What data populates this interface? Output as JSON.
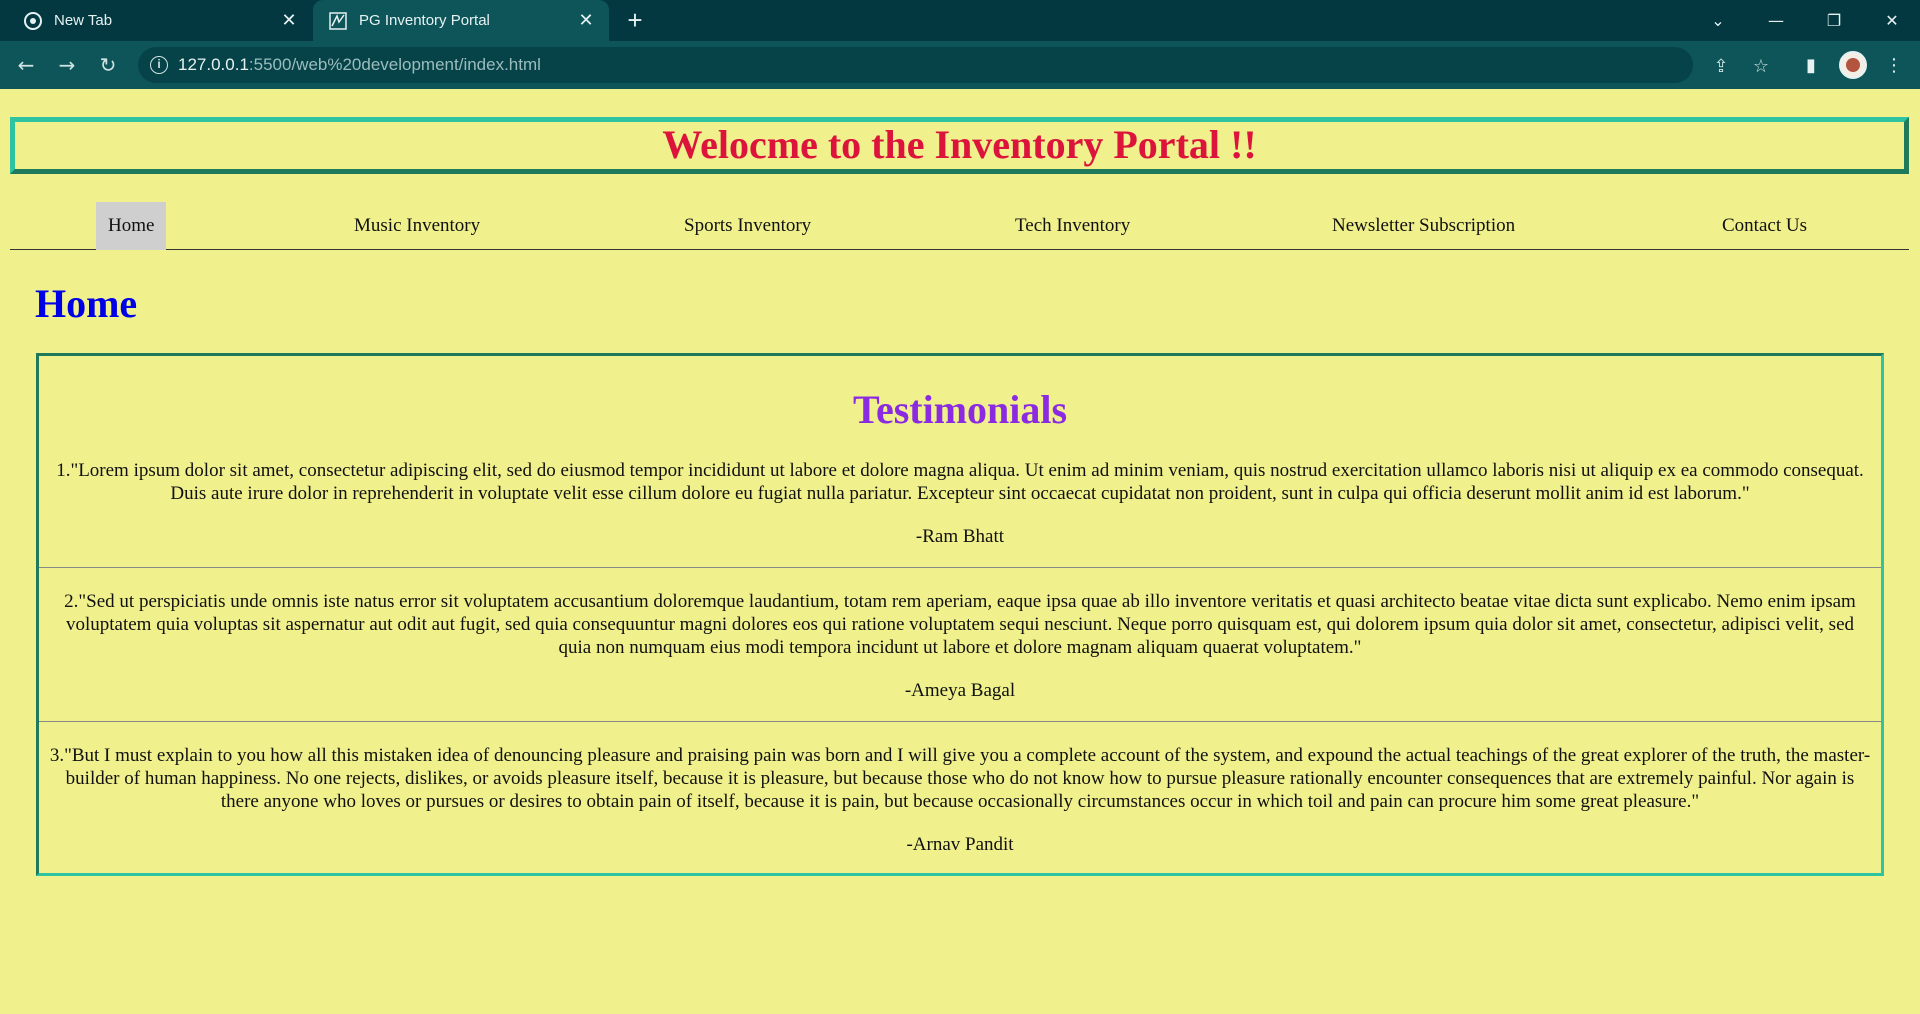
{
  "browser": {
    "tabs": [
      {
        "title": "New Tab",
        "active": false,
        "icon": "chrome-icon"
      },
      {
        "title": "PG Inventory Portal",
        "active": true,
        "icon": "page-favicon"
      }
    ],
    "url_host": "127.0.0.1",
    "url_rest": ":5500/web%20development/index.html",
    "accent_color": "#033840"
  },
  "page": {
    "banner_title": "Welocme to the Inventory Portal !!",
    "nav": [
      {
        "label": "Home",
        "selected": true
      },
      {
        "label": "Music Inventory",
        "selected": false
      },
      {
        "label": "Sports Inventory",
        "selected": false
      },
      {
        "label": "Tech Inventory",
        "selected": false
      },
      {
        "label": "Newsletter Subscription",
        "selected": false
      },
      {
        "label": "Contact Us",
        "selected": false
      }
    ],
    "heading": "Home",
    "testimonials": {
      "title": "Testimonials",
      "items": [
        {
          "text": "1.\"Lorem ipsum dolor sit amet, consectetur adipiscing elit, sed do eiusmod tempor incididunt ut labore et dolore magna aliqua. Ut enim ad minim veniam, quis nostrud exercitation ullamco laboris nisi ut aliquip ex ea commodo consequat. Duis aute irure dolor in reprehenderit in voluptate velit esse cillum dolore eu fugiat nulla pariatur. Excepteur sint occaecat cupidatat non proident, sunt in culpa qui officia deserunt mollit anim id est laborum.\"",
          "author": "-Ram Bhatt"
        },
        {
          "text": "2.\"Sed ut perspiciatis unde omnis iste natus error sit voluptatem accusantium doloremque laudantium, totam rem aperiam, eaque ipsa quae ab illo inventore veritatis et quasi architecto beatae vitae dicta sunt explicabo. Nemo enim ipsam voluptatem quia voluptas sit aspernatur aut odit aut fugit, sed quia consequuntur magni dolores eos qui ratione voluptatem sequi nesciunt. Neque porro quisquam est, qui dolorem ipsum quia dolor sit amet, consectetur, adipisci velit, sed quia non numquam eius modi tempora incidunt ut labore et dolore magnam aliquam quaerat voluptatem.\"",
          "author": "-Ameya Bagal"
        },
        {
          "text": "3.\"But I must explain to you how all this mistaken idea of denouncing pleasure and praising pain was born and I will give you a complete account of the system, and expound the actual teachings of the great explorer of the truth, the master-builder of human happiness. No one rejects, dislikes, or avoids pleasure itself, because it is pleasure, but because those who do not know how to pursue pleasure rationally encounter consequences that are extremely painful. Nor again is there anyone who loves or pursues or desires to obtain pain of itself, because it is pain, but because occasionally circumstances occur in which toil and pain can procure him some great pleasure.\"",
          "author": "-Arnav Pandit"
        }
      ]
    },
    "colors": {
      "background": "#f0f08c",
      "banner_title": "#dc143c",
      "heading": "#0000e6",
      "testimonials_title": "#8a2be2"
    }
  }
}
